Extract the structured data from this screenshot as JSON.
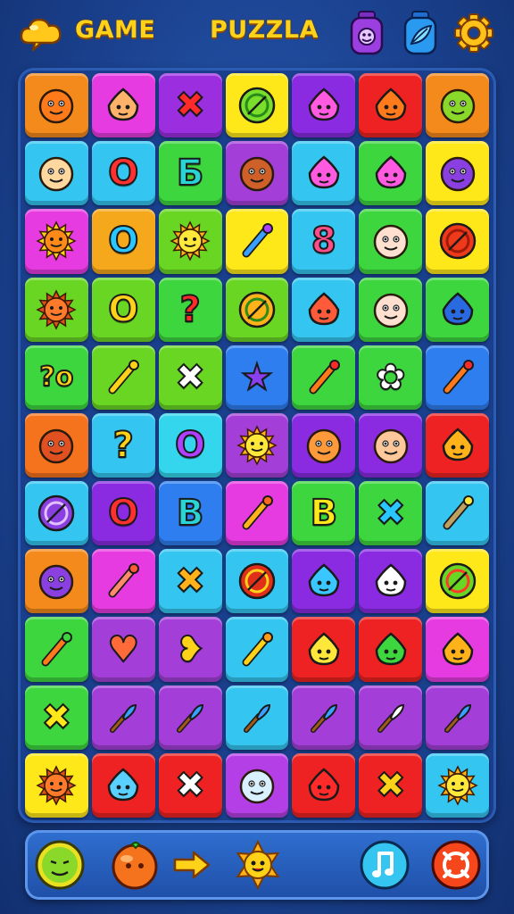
{
  "header": {
    "title_left": "GAME",
    "title_right": "PUZZLA",
    "icons": [
      "cloud-icon",
      "potion-jar-icon",
      "water-drop-jar-icon",
      "gear-icon"
    ]
  },
  "board": {
    "tiles": [
      {
        "color": "#f58a1c",
        "icon": "cat-face-icon"
      },
      {
        "color": "#e63be0",
        "icon": "ice-cream-cone-icon"
      },
      {
        "color": "#9b2fe0",
        "icon": "x-mark-icon",
        "glyph": "✖",
        "glyph_color": "#ff2a2a"
      },
      {
        "color": "#ffe81a",
        "icon": "leaf-disc-icon"
      },
      {
        "color": "#8a2be2",
        "icon": "capsule-icon"
      },
      {
        "color": "#ee2222",
        "icon": "tiki-mask-icon"
      },
      {
        "color": "#f58a1c",
        "icon": "monster-face-icon"
      },
      {
        "color": "#34c6f0",
        "icon": "kitten-face-icon"
      },
      {
        "color": "#34c6f0",
        "icon": "ring-icon",
        "glyph": "O",
        "glyph_color": "#ff3030"
      },
      {
        "color": "#3ed63e",
        "icon": "letter-b-icon",
        "glyph": "Б",
        "glyph_color": "#2ad4d4"
      },
      {
        "color": "#a33fd8",
        "icon": "smiling-face-icon"
      },
      {
        "color": "#34c6f0",
        "icon": "capsule-pair-icon"
      },
      {
        "color": "#3ed63e",
        "icon": "puzzle-blob-icon"
      },
      {
        "color": "#ffe81a",
        "icon": "purple-ball-face-icon"
      },
      {
        "color": "#e63be0",
        "icon": "sun-medallion-icon"
      },
      {
        "color": "#f5a81c",
        "icon": "ring-icon",
        "glyph": "O",
        "glyph_color": "#29c6ff"
      },
      {
        "color": "#6ad624",
        "icon": "sun-face-icon"
      },
      {
        "color": "#ffe81a",
        "icon": "crayon-icon"
      },
      {
        "color": "#34c6f0",
        "icon": "figure-eight-icon",
        "glyph": "8",
        "glyph_color": "#ff4d8a"
      },
      {
        "color": "#3ed63e",
        "icon": "troll-face-icon"
      },
      {
        "color": "#ffe81a",
        "icon": "planet-ball-icon"
      },
      {
        "color": "#6ad624",
        "icon": "sunflower-face-icon"
      },
      {
        "color": "#6ad624",
        "icon": "ring-icon",
        "glyph": "O",
        "glyph_color": "#ffd21a"
      },
      {
        "color": "#3ed63e",
        "icon": "question-mark-icon",
        "glyph": "?",
        "glyph_color": "#ff2a2a"
      },
      {
        "color": "#6ad624",
        "icon": "compass-disc-icon"
      },
      {
        "color": "#34c6f0",
        "icon": "shield-gem-icon"
      },
      {
        "color": "#3ed63e",
        "icon": "troll-face-icon"
      },
      {
        "color": "#3ed63e",
        "icon": "blue-slime-icon"
      },
      {
        "color": "#3ed63e",
        "icon": "question-o-icon",
        "glyph": "?o",
        "glyph_color": "#ffd21a"
      },
      {
        "color": "#6ad624",
        "icon": "stick-icon"
      },
      {
        "color": "#6ad624",
        "icon": "x-mark-icon",
        "glyph": "✖",
        "glyph_color": "#ffffff"
      },
      {
        "color": "#2f7ef0",
        "icon": "star-icon",
        "glyph": "★",
        "glyph_color": "#8a3ff0"
      },
      {
        "color": "#3ed63e",
        "icon": "matchstick-icon"
      },
      {
        "color": "#3ed63e",
        "icon": "cloud-puff-icon",
        "glyph": "✿",
        "glyph_color": "#ffffff"
      },
      {
        "color": "#2f7ef0",
        "icon": "matchstick-icon"
      },
      {
        "color": "#f5731c",
        "icon": "helmet-face-icon"
      },
      {
        "color": "#34c6f0",
        "icon": "question-mark-icon",
        "glyph": "?",
        "glyph_color": "#ffd21a"
      },
      {
        "color": "#34d6ee",
        "icon": "ring-icon",
        "glyph": "O",
        "glyph_color": "#b040ff"
      },
      {
        "color": "#a33fd8",
        "icon": "sun-face-icon"
      },
      {
        "color": "#8a2be2",
        "icon": "basket-face-icon"
      },
      {
        "color": "#8a2be2",
        "icon": "punk-face-icon"
      },
      {
        "color": "#ee2222",
        "icon": "flame-icon"
      },
      {
        "color": "#34c6f0",
        "icon": "marble-icon"
      },
      {
        "color": "#8a2be2",
        "icon": "ring-icon",
        "glyph": "O",
        "glyph_color": "#ff3030"
      },
      {
        "color": "#2f7ef0",
        "icon": "letter-b-icon",
        "glyph": "B",
        "glyph_color": "#2ad4d4"
      },
      {
        "color": "#e63be0",
        "icon": "torch-icon"
      },
      {
        "color": "#3ed63e",
        "icon": "letter-b-icon",
        "glyph": "B",
        "glyph_color": "#ffe81a"
      },
      {
        "color": "#3ed63e",
        "icon": "x-mark-icon",
        "glyph": "✖",
        "glyph_color": "#29c6ff"
      },
      {
        "color": "#34c6f0",
        "icon": "popsicle-icon"
      },
      {
        "color": "#f58a1c",
        "icon": "purple-ball-face-icon"
      },
      {
        "color": "#e63be0",
        "icon": "baton-icon"
      },
      {
        "color": "#34c6f0",
        "icon": "x-mark-icon",
        "glyph": "✖",
        "glyph_color": "#ffb21a"
      },
      {
        "color": "#34c6f0",
        "icon": "red-ball-icon"
      },
      {
        "color": "#8a2be2",
        "icon": "jar-icon"
      },
      {
        "color": "#8a2be2",
        "icon": "ufo-icon"
      },
      {
        "color": "#ffe81a",
        "icon": "clock-disc-icon"
      },
      {
        "color": "#3ed63e",
        "icon": "carrot-icon"
      },
      {
        "color": "#a33fd8",
        "icon": "heart-icon",
        "glyph": "♥",
        "glyph_color": "#ff6a3a"
      },
      {
        "color": "#a33fd8",
        "icon": "curl-heart-icon",
        "glyph": "❥",
        "glyph_color": "#ffd21a"
      },
      {
        "color": "#34c6f0",
        "icon": "broom-icon"
      },
      {
        "color": "#ee2222",
        "icon": "bunny-ears-icon"
      },
      {
        "color": "#ee2222",
        "icon": "gem-icon"
      },
      {
        "color": "#e63be0",
        "icon": "burger-icon"
      },
      {
        "color": "#3ed63e",
        "icon": "x-mark-icon",
        "glyph": "✖",
        "glyph_color": "#ffe81a"
      },
      {
        "color": "#a33fd8",
        "icon": "paintbrush-icon"
      },
      {
        "color": "#a33fd8",
        "icon": "paintbrush-icon"
      },
      {
        "color": "#34c6f0",
        "icon": "paintbrush-icon"
      },
      {
        "color": "#a33fd8",
        "icon": "paintbrush-icon"
      },
      {
        "color": "#a33fd8",
        "icon": "scribble-icon"
      },
      {
        "color": "#a33fd8",
        "icon": "paintbrush-icon"
      },
      {
        "color": "#ffe81a",
        "icon": "sunflower-face-icon"
      },
      {
        "color": "#ee2222",
        "icon": "water-drop-icon"
      },
      {
        "color": "#ee2222",
        "icon": "x-mark-icon",
        "glyph": "✖",
        "glyph_color": "#ffffff"
      },
      {
        "color": "#b53fe6",
        "icon": "ghost-cat-icon"
      },
      {
        "color": "#ee2222",
        "icon": "balloon-icon"
      },
      {
        "color": "#ee2222",
        "icon": "x-mark-icon",
        "glyph": "✖",
        "glyph_color": "#ffd21a"
      },
      {
        "color": "#34c6f0",
        "icon": "sun-face-icon"
      }
    ]
  },
  "bottom_bar": {
    "items": [
      "green-face-icon",
      "orange-fruit-icon",
      "arrow-right-icon",
      "sun-sprite-icon",
      "music-note-icon",
      "target-icon"
    ]
  }
}
